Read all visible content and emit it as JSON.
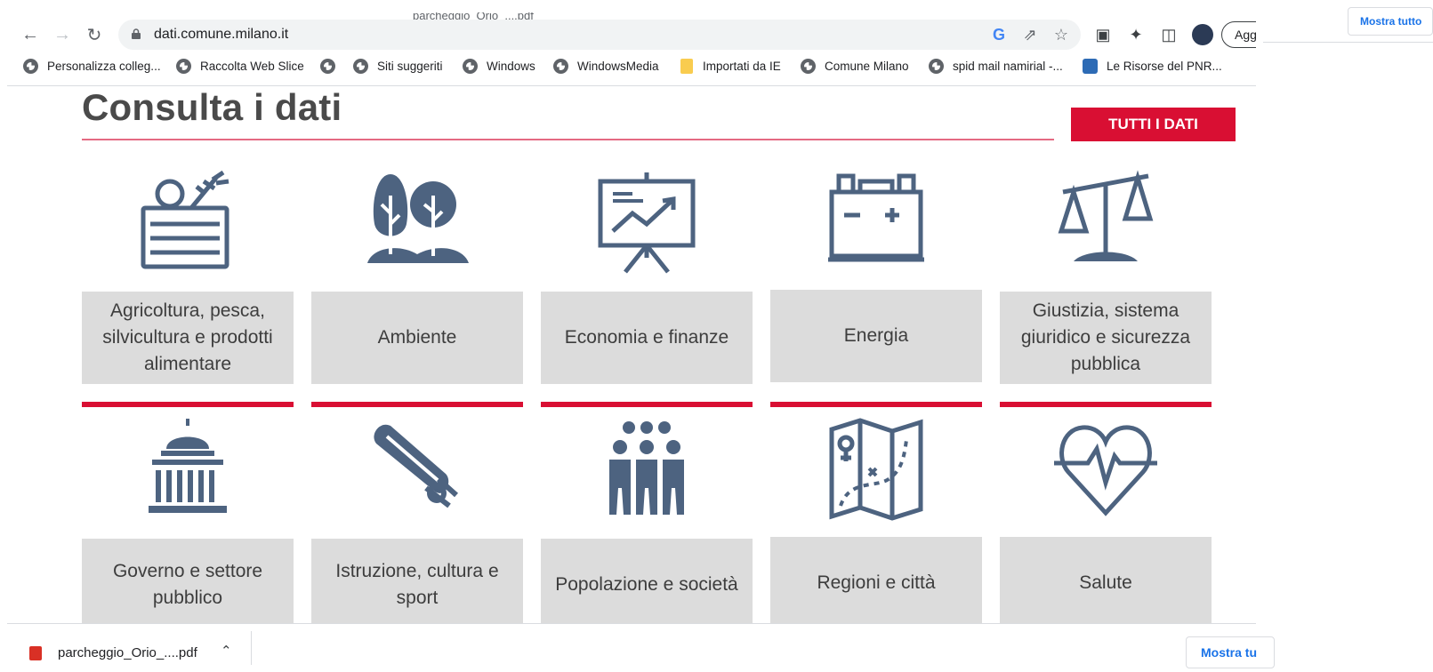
{
  "browser": {
    "url": "dati.comune.milano.it",
    "update_button": "Agg",
    "tab_ghost": "parcheggio_Orio_....pdf"
  },
  "bookmarks": [
    {
      "label": "Personalizza colleg...",
      "icon": "globe-icon"
    },
    {
      "label": "Raccolta Web Slice",
      "icon": "globe-icon"
    },
    {
      "label": "",
      "icon": "globe-icon"
    },
    {
      "label": "Siti suggeriti",
      "icon": "globe-icon"
    },
    {
      "label": "Windows",
      "icon": "globe-icon"
    },
    {
      "label": "WindowsMedia",
      "icon": "globe-icon"
    },
    {
      "label": "Importati da IE",
      "icon": "folder-icon"
    },
    {
      "label": "Comune Milano",
      "icon": "globe-icon"
    },
    {
      "label": "spid mail namirial -...",
      "icon": "globe-icon"
    },
    {
      "label": "Le Risorse del PNR...",
      "icon": "pnr-icon"
    }
  ],
  "page": {
    "heading": "Consulta i dati",
    "all_button": "TUTTI I DATI",
    "accent_color": "#d90f33",
    "icon_color": "#4d6380",
    "categories": [
      {
        "label": "Agricoltura, pesca, silvicultura e prodotti alimentare",
        "icon": "produce-crate-icon"
      },
      {
        "label": "Ambiente",
        "icon": "trees-icon"
      },
      {
        "label": "Economia e finanze",
        "icon": "presentation-chart-icon"
      },
      {
        "label": "Energia",
        "icon": "battery-icon"
      },
      {
        "label": "Giustizia, sistema giuridico e sicurezza pubblica",
        "icon": "scales-icon"
      },
      {
        "label": "Governo e settore pubblico",
        "icon": "capitol-building-icon"
      },
      {
        "label": "Istruzione, cultura e sport",
        "icon": "diploma-scroll-icon"
      },
      {
        "label": "Popolazione e società",
        "icon": "people-group-icon"
      },
      {
        "label": "Regioni e città",
        "icon": "map-icon"
      },
      {
        "label": "Salute",
        "icon": "heart-pulse-icon"
      }
    ]
  },
  "downloads": {
    "file_name": "parcheggio_Orio_....pdf",
    "show_all": "Mostra tu",
    "show_all_top": "Mostra tutto"
  }
}
